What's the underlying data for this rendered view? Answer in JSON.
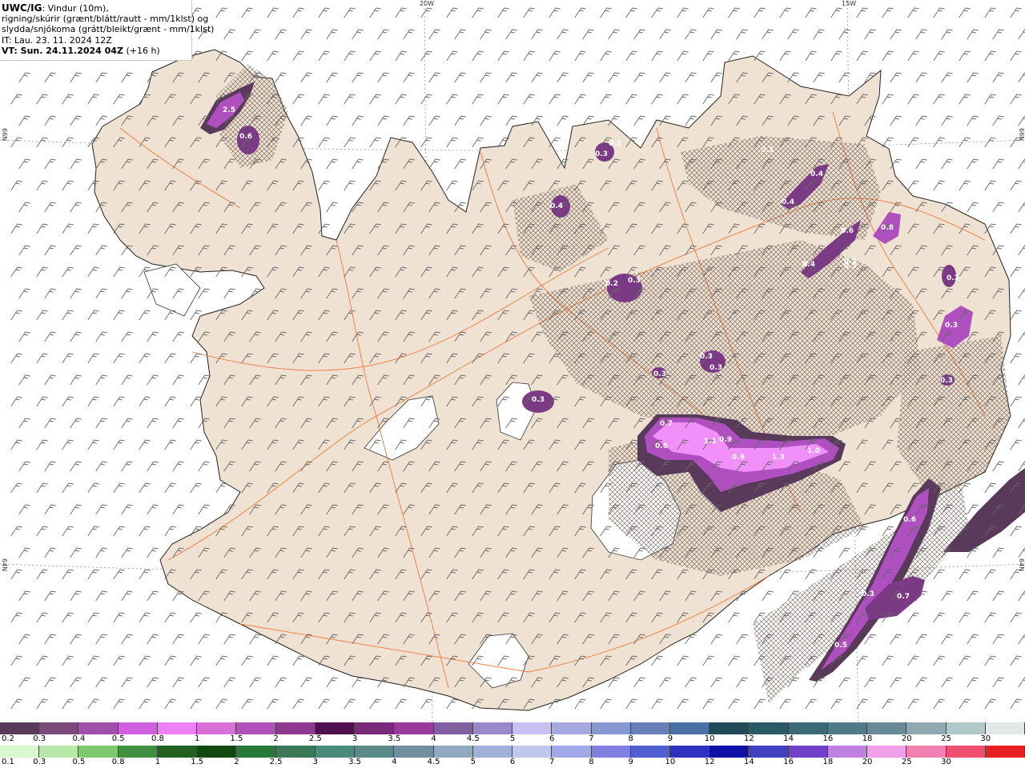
{
  "header": {
    "brand": "UWC/IG",
    "line1_rest": ": Vindur (10m),",
    "line2": "rigning/skúrir (grænt/blátt/rautt - mm/1klst) og",
    "line3": "slydda/snjókoma (grátt/bleikt/grænt - mm/1klst)",
    "it_line": "IT: Lau. 23. 11. 2024 12Z",
    "vt_label": "VT: Sun. 24.11.2024 04Z",
    "vt_lead": "(+16 h)"
  },
  "map": {
    "lon_labels": [
      "20W",
      "15W"
    ],
    "lat_labels": [
      "66N",
      "64N",
      "66N",
      "64N"
    ],
    "land_color": "#f0e2d2",
    "road_color": "#f07a3c",
    "precip_colors": [
      "#5a3a5a",
      "#7a3a84",
      "#b050c0",
      "#d870e8",
      "#f0a0f8"
    ],
    "precip_labels": [
      "2.5",
      "0.6",
      "0.3",
      "0.3",
      "0.4",
      "0.4",
      "0.4",
      "0.6",
      "0.8",
      "0.4",
      "0.9",
      "0.3",
      "0.2",
      "0.3",
      "0.3",
      "0.3",
      "0.3",
      "0.3",
      "0.2",
      "0.3",
      "0.7",
      "0.6",
      "1.1",
      "0.9",
      "0.9",
      "1.3",
      "1.0",
      "0.6",
      "0.3",
      "0.7",
      "0.5",
      "0.3",
      "0.2"
    ]
  },
  "legend": {
    "snow_colors": [
      "#5a3a5a",
      "#7a4a7a",
      "#a050a8",
      "#d060e0",
      "#f080f8",
      "#d870d8",
      "#b050b8",
      "#903890",
      "#501050",
      "#7a2a7a",
      "#9a3a9a",
      "#8060a0",
      "#9a88c8",
      "#c8c0f0",
      "#a8a8e0",
      "#8898d0",
      "#6880b8",
      "#4a70a8",
      "#204a58",
      "#2a5a68",
      "#3a6a78",
      "#507a88",
      "#688a98",
      "#90a8b0",
      "#b0c8c8",
      "#e0e8e8"
    ],
    "snow_labels": [
      "0.2",
      "0.3",
      "0.4",
      "0.5",
      "0.8",
      "1",
      "1.5",
      "2",
      "2.5",
      "3",
      "3.5",
      "4",
      "4.5",
      "5",
      "6",
      "7",
      "8",
      "9",
      "10",
      "12",
      "14",
      "16",
      "18",
      "20",
      "25",
      "30"
    ],
    "rain_colors": [
      "#d8f8d0",
      "#b8e8a8",
      "#80c870",
      "#409040",
      "#206020",
      "#104810",
      "#287838",
      "#3a7858",
      "#4a8a78",
      "#5a8a88",
      "#7090a0",
      "#90a8c0",
      "#a0b0d8",
      "#c0c8f0",
      "#a0a8e8",
      "#8080e0",
      "#5060d0",
      "#3030c0",
      "#1010a8",
      "#4040c0",
      "#7040c8",
      "#c080e0",
      "#f0a0e8",
      "#f080b0",
      "#f05070",
      "#e82020"
    ],
    "rain_labels": [
      "0.1",
      "0.3",
      "0.5",
      "0.8",
      "1",
      "1.5",
      "2",
      "2.5",
      "3",
      "3.5",
      "4",
      "4.5",
      "5",
      "6",
      "7",
      "8",
      "9",
      "10",
      "12",
      "14",
      "16",
      "18",
      "20",
      "25",
      "30"
    ]
  }
}
